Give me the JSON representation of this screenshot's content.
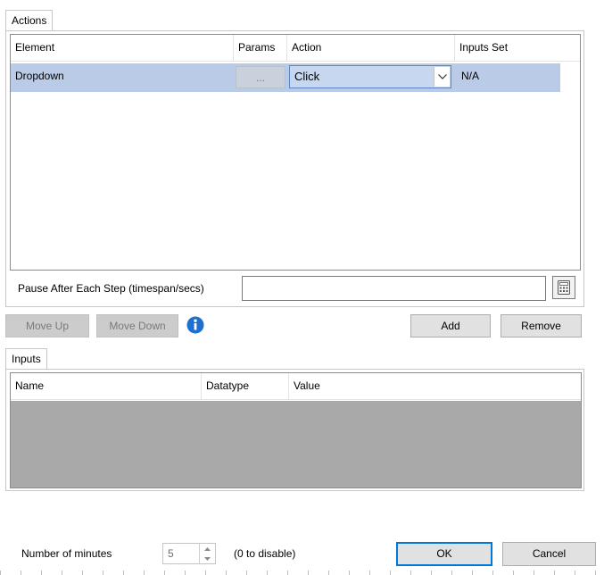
{
  "actions_tab": {
    "label": "Actions",
    "columns": [
      "Element",
      "Params",
      "Action",
      "Inputs Set"
    ],
    "rows": [
      {
        "element": "Dropdown",
        "params": "...",
        "action": "Click",
        "inputs_set": "N/A"
      }
    ],
    "pause_label": "Pause After Each Step (timespan/secs)",
    "pause_value": ""
  },
  "buttons": {
    "move_up": "Move Up",
    "move_down": "Move Down",
    "add": "Add",
    "remove": "Remove",
    "ok": "OK",
    "cancel": "Cancel"
  },
  "inputs_tab": {
    "label": "Inputs",
    "columns": [
      "Name",
      "Datatype",
      "Value"
    ]
  },
  "footer": {
    "minutes_label": "Number of minutes",
    "minutes_value": "5",
    "minutes_hint": "(0 to disable)"
  },
  "colors": {
    "selected_row": "#b9cbe6",
    "info_icon": "#1f6fd0",
    "empty_grid": "#a9a9a9",
    "default_border": "#0078d7"
  },
  "icons": {
    "dropdown_arrow": "chevron-down-icon",
    "calculator": "calculator-icon",
    "info": "info-icon",
    "spin_up": "spin-up-icon",
    "spin_down": "spin-down-icon"
  }
}
